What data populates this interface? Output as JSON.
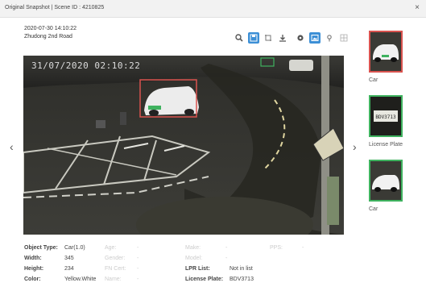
{
  "window": {
    "title": "Original Snapshot | Scene ID : 4210825",
    "close_label": "×"
  },
  "meta": {
    "datetime": "2020-07-30 14:10:22",
    "location": "Zhudong 2nd Road"
  },
  "toolbar": {
    "group1": [
      "search-icon",
      "save-icon",
      "crop-icon",
      "download-icon"
    ],
    "group2": [
      "settings-icon",
      "image-icon",
      "pin-icon",
      "grid-icon"
    ]
  },
  "scene": {
    "osd_timestamp": "31/07/2020 02:10:22",
    "nav_prev": "‹",
    "nav_next": "›"
  },
  "details": {
    "object_type_label": "Object Type:",
    "object_type_value": "Car(1.0)",
    "width_label": "Width:",
    "width_value": "345",
    "height_label": "Height:",
    "height_value": "234",
    "color_label": "Color:",
    "color_value": "Yellow.White",
    "age_label": "Age:",
    "age_value": "-",
    "gender_label": "Gender:",
    "gender_value": "-",
    "fn_cert_label": "FN Cert:",
    "fn_cert_value": "-",
    "name_label": "Name:",
    "name_value": "-",
    "make_label": "Make:",
    "make_value": "-",
    "model_label": "Model:",
    "model_value": "-",
    "lpr_list_label": "LPR List:",
    "lpr_list_value": "Not in list",
    "plate_label": "License Plate:",
    "plate_value": "BDV3713",
    "pps_label": "PPS:",
    "pps_value": "-"
  },
  "thumbnails": [
    {
      "caption": "Car",
      "border": "#d9534f"
    },
    {
      "caption": "License Plate",
      "border": "#3fb25f",
      "plate_text": "BDV3713"
    },
    {
      "caption": "Car",
      "border": "#3fb25f"
    }
  ],
  "colors": {
    "accent": "#3c8fd6",
    "detection_red": "#d9534f",
    "detection_green": "#3fb25f"
  }
}
